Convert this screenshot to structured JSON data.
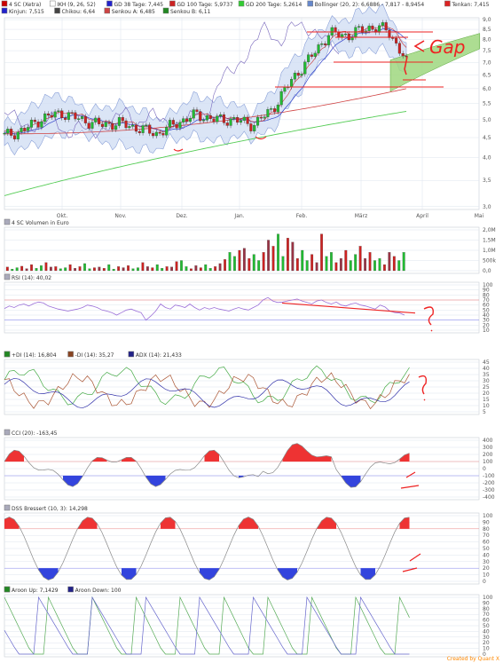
{
  "chart_data": [
    {
      "panel": "price",
      "type": "line",
      "title": "4 SC (Xetra)",
      "legend_row1": [
        {
          "label": "4 SC (Xetra)",
          "color": "#cc0000"
        },
        {
          "label": "IKH (9, 26, 52)",
          "color": "#ffffff"
        },
        {
          "label": "GD 38 Tage: 7,445",
          "color": "#2222cc"
        },
        {
          "label": "GD 100 Tage: 5,9737",
          "color": "#cc2222"
        },
        {
          "label": "GD 200 Tage: 5,2614",
          "color": "#33cc33"
        },
        {
          "label": "Bollinger (20, 2): 6,6886 - 7,817 - 8,9454",
          "color": "#6688cc"
        },
        {
          "label": "Tenkan: 7,415",
          "color": "#dd2222"
        }
      ],
      "legend_row2": [
        {
          "label": "Kinjun: 7,515",
          "color": "#2222cc"
        },
        {
          "label": "Chikou: 6,64",
          "color": "#444444"
        },
        {
          "label": "Senkou A: 6,485",
          "color": "#cc4444"
        },
        {
          "label": "Senkou B: 6,11",
          "color": "#228822"
        }
      ],
      "x_ticks": [
        "Okt.",
        "Nov.",
        "Dez.",
        "Jan.",
        "Feb.",
        "März",
        "April",
        "Mai"
      ],
      "y_ticks": [
        "9,0",
        "8,5",
        "8,0",
        "7,5",
        "7,0",
        "6,5",
        "6,0",
        "5,5",
        "5,0",
        "4,5",
        "4,0",
        "3,5",
        "3,0"
      ],
      "y_values": [
        9.0,
        8.5,
        8.0,
        7.5,
        7.0,
        6.5,
        6.0,
        5.5,
        5.0,
        4.5,
        4.0,
        3.5,
        3.0
      ],
      "ylim": [
        2.95,
        9.1
      ],
      "scale": "log",
      "series": [
        {
          "name": "4 SC (Xetra)",
          "x": [
            0,
            0.04,
            0.08,
            0.12,
            0.16,
            0.2,
            0.24,
            0.28,
            0.32,
            0.36,
            0.4,
            0.44,
            0.48,
            0.52,
            0.56,
            0.6,
            0.64,
            0.68,
            0.72,
            0.76,
            0.8,
            0.84
          ],
          "values": [
            4.55,
            4.7,
            5.05,
            5.2,
            5.0,
            4.85,
            4.9,
            4.75,
            4.6,
            4.9,
            5.15,
            5.0,
            5.0,
            4.85,
            5.3,
            6.3,
            7.2,
            8.3,
            8.2,
            8.6,
            8.5,
            7.0
          ]
        },
        {
          "name": "GD 200 Tage",
          "values": [
            3.2,
            5.25
          ]
        },
        {
          "name": "Bollinger",
          "values": [
            7.4,
            8.9
          ]
        }
      ],
      "annotations": [
        "Gap"
      ]
    },
    {
      "panel": "volume",
      "type": "bar",
      "title": "4 SC Volumen in Euro",
      "y_ticks": [
        "2,0M",
        "1,5M",
        "1,0M",
        "500k",
        "0,0"
      ],
      "y_values": [
        2000000,
        1500000,
        1000000,
        500000,
        0
      ],
      "values": [
        0.18,
        0.08,
        0.15,
        0.22,
        0.1,
        0.3,
        0.12,
        0.25,
        0.4,
        0.18,
        0.2,
        0.1,
        0.15,
        0.3,
        0.12,
        0.2,
        0.35,
        0.1,
        0.15,
        0.18,
        0.12,
        0.3,
        0.08,
        0.2,
        0.15,
        0.25,
        0.1,
        0.15,
        0.4,
        0.2,
        0.15,
        0.3,
        0.12,
        0.2,
        0.18,
        0.45,
        0.5,
        0.2,
        0.1,
        0.25,
        0.15,
        0.3,
        0.12,
        0.2,
        0.35,
        0.55,
        0.9,
        0.7,
        1.0,
        1.1,
        0.6,
        0.8,
        0.5,
        0.9,
        1.5,
        1.2,
        1.8,
        0.7,
        1.6,
        1.4,
        0.6,
        1.0,
        0.5,
        0.8,
        0.4,
        1.8,
        0.7,
        0.9,
        0.4,
        0.6,
        1.0,
        0.5,
        0.8,
        1.2,
        0.6,
        0.9,
        0.5,
        0.6,
        0.3,
        0.9,
        0.7,
        0.5,
        0.9
      ]
    },
    {
      "panel": "rsi",
      "type": "line",
      "title": "RSI (14): 40,02",
      "y_ticks": [
        "100",
        "90",
        "80",
        "70",
        "60",
        "50",
        "40",
        "30",
        "20",
        "10"
      ],
      "y_values": [
        100,
        90,
        80,
        70,
        60,
        50,
        40,
        30,
        20,
        10
      ],
      "series": [
        {
          "name": "RSI (14)",
          "values": [
            53,
            58,
            55,
            60,
            62,
            58,
            63,
            66,
            64,
            58,
            55,
            52,
            50,
            48,
            50,
            52,
            55,
            60,
            58,
            55,
            50,
            48,
            45,
            40,
            45,
            50,
            52,
            48,
            45,
            30,
            38,
            48,
            62,
            55,
            52,
            60,
            58,
            55,
            62,
            55,
            50,
            55,
            52,
            55,
            52,
            50,
            48,
            52,
            55,
            52,
            50,
            55,
            60,
            70,
            75,
            68,
            65,
            66,
            68,
            70,
            72,
            68,
            65,
            62,
            68,
            70,
            65,
            62,
            66,
            60,
            58,
            62,
            64,
            60,
            58,
            55,
            52,
            60,
            56,
            48,
            45,
            44,
            40
          ]
        }
      ]
    },
    {
      "panel": "dmi",
      "type": "line",
      "title": "+DI (14): 16,804",
      "legend": [
        {
          "label": "+DI (14): 16,804",
          "color": "#228822"
        },
        {
          "label": "-DI (14): 35,27",
          "color": "#884422"
        },
        {
          "label": "ADX (14): 21,433",
          "color": "#222288"
        }
      ],
      "y_ticks": [
        "45",
        "40",
        "35",
        "30",
        "25",
        "20",
        "15",
        "10",
        "5"
      ],
      "y_values": [
        45,
        40,
        35,
        30,
        25,
        20,
        15,
        10,
        5
      ]
    },
    {
      "panel": "cci",
      "type": "line",
      "title": "CCI (20): -163,45",
      "y_ticks": [
        "400",
        "300",
        "200",
        "100",
        "0",
        "-100",
        "-200",
        "-300",
        "-400"
      ],
      "y_values": [
        400,
        300,
        200,
        100,
        0,
        -100,
        -200,
        -300,
        -400
      ]
    },
    {
      "panel": "stochastic",
      "type": "line",
      "title": "DSS Bressert (10, 3): 14,298",
      "y_ticks": [
        "100",
        "90",
        "80",
        "70",
        "60",
        "50",
        "40",
        "30",
        "20",
        "10",
        "0"
      ],
      "y_values": [
        100,
        90,
        80,
        70,
        60,
        50,
        40,
        30,
        20,
        10,
        0
      ]
    },
    {
      "panel": "aroon",
      "type": "line",
      "title": "Aroon Up: 7,1429",
      "legend": [
        {
          "label": "Aroon Up: 7,1429",
          "color": "#228822"
        },
        {
          "label": "Aroon Down: 100",
          "color": "#222288"
        }
      ],
      "y_ticks": [
        "100",
        "90",
        "80",
        "70",
        "60",
        "50",
        "40",
        "30",
        "20",
        "10",
        "0"
      ],
      "y_values": [
        100,
        90,
        80,
        70,
        60,
        50,
        40,
        30,
        20,
        10,
        0
      ]
    }
  ],
  "footer": {
    "credit": "Created by Quant X",
    "color": "#ff8800"
  },
  "colors": {
    "axis_text": "#555555",
    "grid": "#dde4ee",
    "border": "#999999",
    "ruler_red": "#ee2222"
  }
}
